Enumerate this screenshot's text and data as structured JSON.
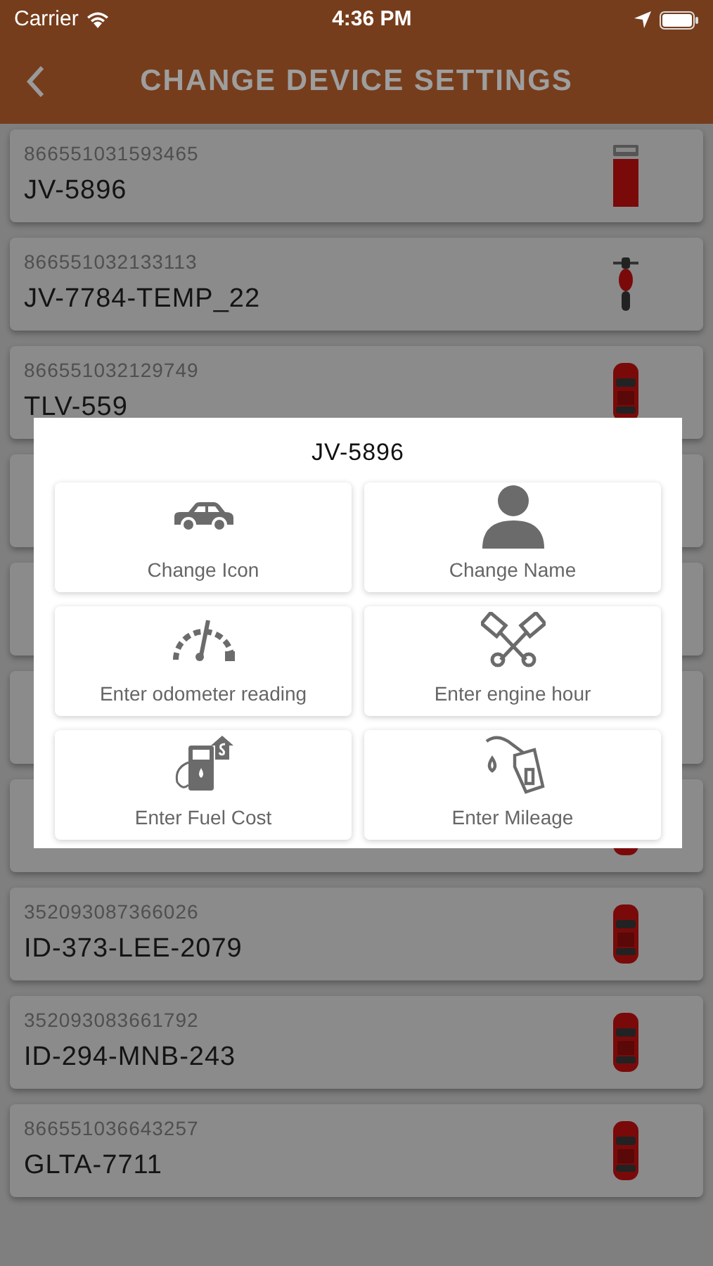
{
  "status_bar": {
    "carrier": "Carrier",
    "time": "4:36 PM"
  },
  "header": {
    "title": "CHANGE DEVICE SETTINGS"
  },
  "devices": [
    {
      "kind": "truck",
      "id": "866551031593465",
      "name": "JV-5896"
    },
    {
      "kind": "motorcycle",
      "id": "866551032133113",
      "name": "JV-7784-TEMP_22"
    },
    {
      "kind": "car",
      "id": "866551032129749",
      "name": "TLV-559"
    },
    {
      "kind": "covered"
    },
    {
      "kind": "covered"
    },
    {
      "kind": "covered"
    },
    {
      "kind": "car"
    },
    {
      "kind": "car",
      "id": "352093087366026",
      "name": "ID-373-LEE-2079"
    },
    {
      "kind": "car",
      "id": "352093083661792",
      "name": "ID-294-MNB-243"
    },
    {
      "kind": "car",
      "id": "866551036643257",
      "name": "GLTA-7711"
    }
  ],
  "dialog": {
    "title": "JV-5896",
    "options": [
      {
        "kind": "car",
        "label": "Change Icon"
      },
      {
        "kind": "person",
        "label": "Change Name"
      },
      {
        "kind": "gauge",
        "label": "Enter odometer reading"
      },
      {
        "kind": "pistons",
        "label": "Enter engine hour"
      },
      {
        "kind": "fuel-cost",
        "label": "Enter Fuel Cost"
      },
      {
        "kind": "nozzle",
        "label": "Enter Mileage"
      }
    ]
  }
}
